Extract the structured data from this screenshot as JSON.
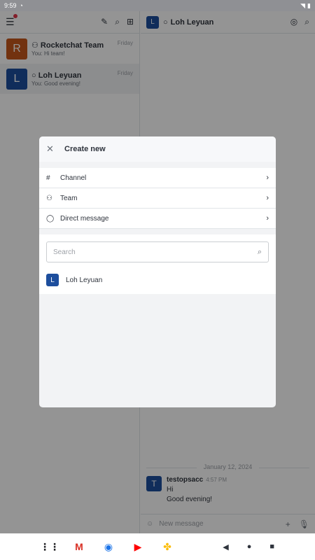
{
  "status": {
    "time": "9:59"
  },
  "left_panel": {
    "rooms": [
      {
        "avatar_letter": "R",
        "avatar_color": "#c4571a",
        "name": "Rocketchat Team",
        "preview": "You: Hi team!",
        "time": "Friday",
        "active": false
      },
      {
        "avatar_letter": "L",
        "avatar_color": "#1d4e9d",
        "name": "Loh Leyuan",
        "preview": "You: Good evening!",
        "time": "Friday",
        "active": true
      }
    ]
  },
  "chat": {
    "avatar_letter": "L",
    "avatar_color": "#1d4e9d",
    "title": "Loh Leyuan",
    "day_separator": "January 12, 2024",
    "message": {
      "avatar_letter": "T",
      "avatar_color": "#1d4e9d",
      "user": "testopsacc",
      "time": "4:57 PM",
      "lines": [
        "Hi",
        "Good evening!"
      ]
    },
    "composer_placeholder": "New message"
  },
  "modal": {
    "title": "Create new",
    "options": [
      {
        "label": "Channel",
        "icon": "hash-icon"
      },
      {
        "label": "Team",
        "icon": "team-icon"
      },
      {
        "label": "Direct message",
        "icon": "message-icon"
      }
    ],
    "search_placeholder": "Search",
    "user": {
      "avatar_letter": "L",
      "avatar_color": "#1d4e9d",
      "name": "Loh Leyuan"
    }
  },
  "colors": {
    "accent": "#1d4e9d",
    "overlay": "#6b6c70",
    "badge": "#e0364b"
  }
}
